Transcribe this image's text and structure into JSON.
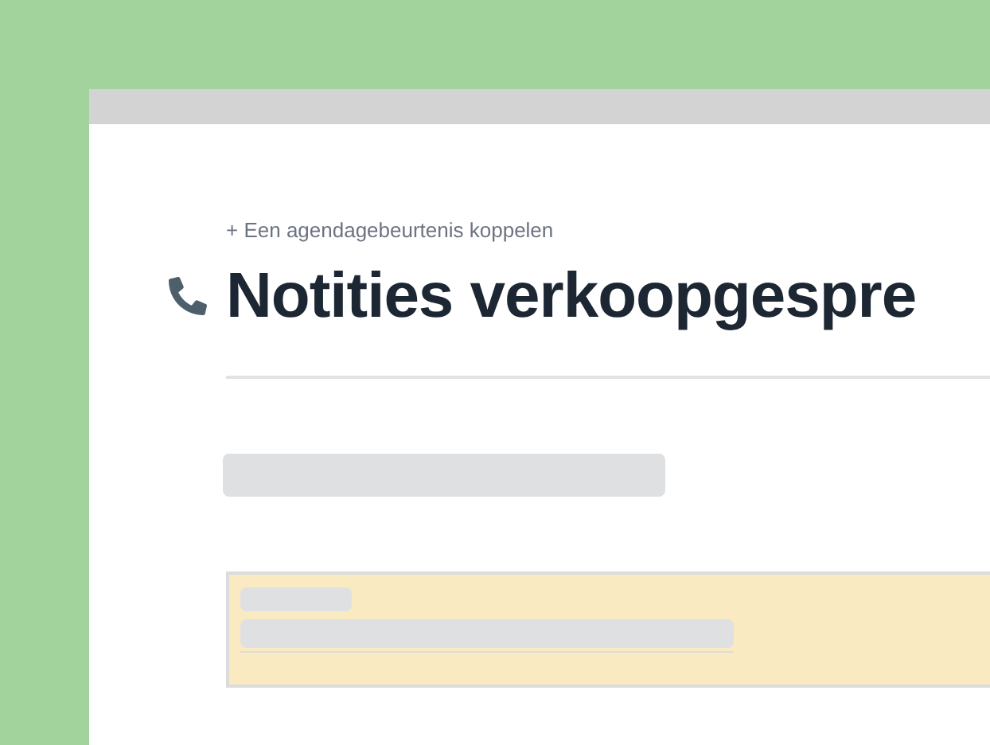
{
  "link": {
    "text": "+ Een agendagebeurtenis koppelen"
  },
  "title": "Notities verkoopgespre"
}
